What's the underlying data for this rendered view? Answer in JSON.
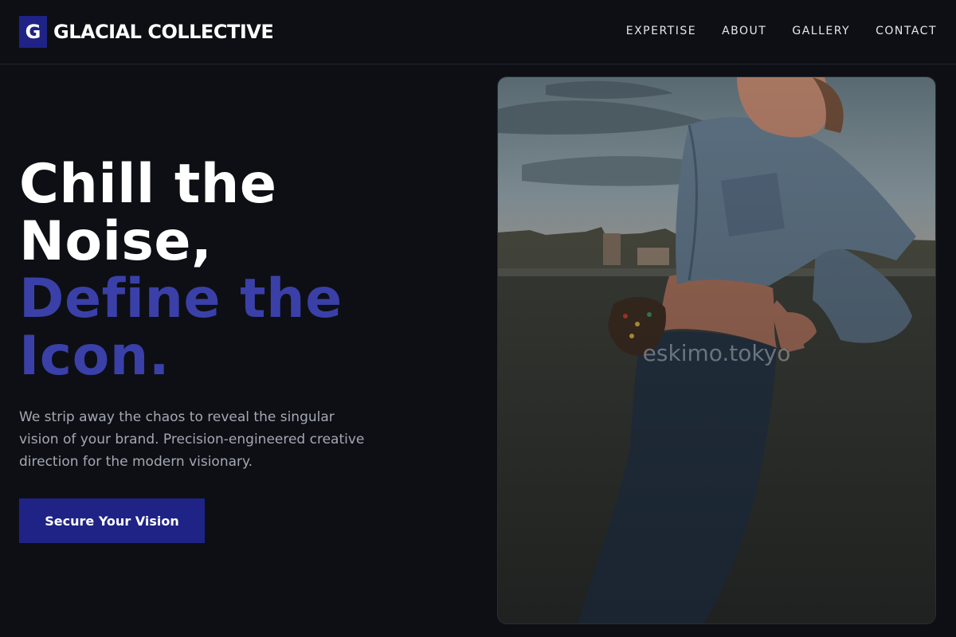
{
  "brand": {
    "mark": "G",
    "name": "GLACIAL COLLECTIVE"
  },
  "nav": {
    "items": [
      {
        "label": "EXPERTISE"
      },
      {
        "label": "ABOUT"
      },
      {
        "label": "GALLERY"
      },
      {
        "label": "CONTACT"
      }
    ]
  },
  "hero": {
    "title_lines": [
      "Chill the",
      "Noise,"
    ],
    "accent_lines": [
      "Define the",
      "Icon."
    ],
    "description": "We strip away the chaos to reveal the singular vision of your brand. Precision-engineered creative direction for the modern visionary.",
    "cta_label": "Secure Your Vision"
  },
  "photo": {
    "watermark": "eskimo.tokyo"
  },
  "colors": {
    "background": "#0d0f14",
    "accent": "#1f2385",
    "accent_text": "#3a40a8",
    "body_text": "#a4a8b3"
  }
}
